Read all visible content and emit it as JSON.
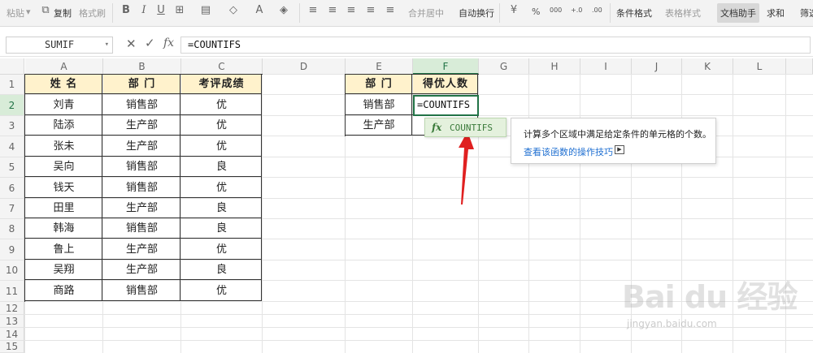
{
  "toolbar": {
    "paste": "粘贴",
    "copy": "复制",
    "format_painter": "格式刷",
    "merge_center": "合并居中",
    "wrap_text": "自动换行",
    "percent": "%",
    "thousands": "000",
    "inc_decimal": "+.0",
    "dec_decimal": ".00",
    "conditional_format": "条件格式",
    "table_style": "表格样式",
    "doc_helper": "文档助手",
    "sum": "求和",
    "filter": "筛选"
  },
  "formula_bar": {
    "name_box": "SUMIF",
    "fx": "fx",
    "formula": "=COUNTIFS"
  },
  "columns": [
    "A",
    "B",
    "C",
    "D",
    "E",
    "F",
    "G",
    "H",
    "I",
    "J",
    "K",
    "L"
  ],
  "rows": [
    "1",
    "2",
    "3",
    "4",
    "5",
    "6",
    "7",
    "8",
    "9",
    "10",
    "11",
    "12",
    "13",
    "14",
    "15"
  ],
  "table1": {
    "headers": [
      "姓 名",
      "部 门",
      "考评成绩"
    ],
    "rows": [
      [
        "刘青",
        "销售部",
        "优"
      ],
      [
        "陆添",
        "生产部",
        "优"
      ],
      [
        "张未",
        "生产部",
        "优"
      ],
      [
        "吴向",
        "销售部",
        "良"
      ],
      [
        "钱天",
        "销售部",
        "优"
      ],
      [
        "田里",
        "生产部",
        "良"
      ],
      [
        "韩海",
        "销售部",
        "良"
      ],
      [
        "鲁上",
        "生产部",
        "优"
      ],
      [
        "吴翔",
        "生产部",
        "良"
      ],
      [
        "商路",
        "销售部",
        "优"
      ]
    ]
  },
  "table2": {
    "headers": [
      "部 门",
      "得优人数"
    ],
    "rows": [
      [
        "销售部",
        "=COUNTIFS"
      ],
      [
        "生产部",
        ""
      ]
    ]
  },
  "autocomplete": {
    "fx": "fx",
    "function_name": "COUNTIFS"
  },
  "tooltip": {
    "description": "计算多个区域中满足给定条件的单元格的个数。",
    "link": "查看该函数的操作技巧"
  },
  "watermark": {
    "logo": "Bai du 经验",
    "url": "jingyan.baidu.com"
  },
  "colors": {
    "header_fill": "#fff2cc",
    "active_green": "#217346",
    "link_blue": "#1f6fd1",
    "arrow_red": "#e02020"
  }
}
